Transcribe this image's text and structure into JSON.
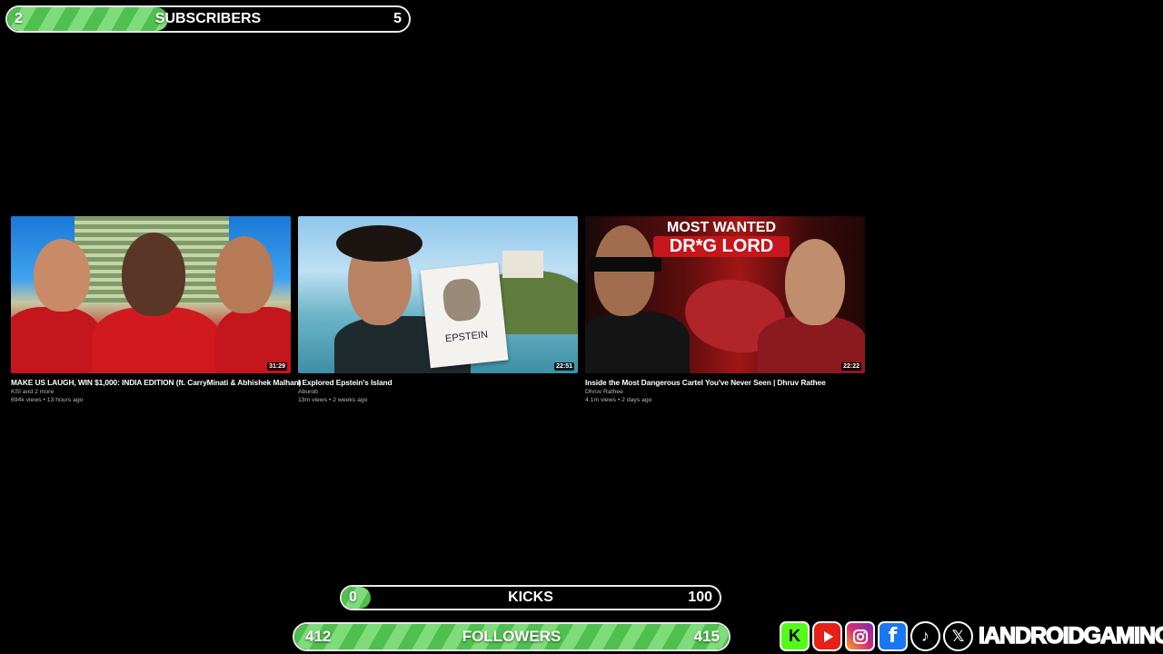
{
  "goals": {
    "subscribers": {
      "label": "SUBSCRIBERS",
      "min": "2",
      "max": "5",
      "progress": 0.4
    },
    "kicks": {
      "label": "KICKS",
      "min": "0",
      "max": "100",
      "progress": 0.0
    },
    "followers": {
      "label": "FOLLOWERS",
      "min": "412",
      "max": "415",
      "progress": 1.0
    }
  },
  "videos": [
    {
      "title": "MAKE US LAUGH, WIN $1,000: INDIA EDITION (ft. CarryMinati & Abhishek Malhan)",
      "channel": "KSI and 2 more",
      "meta": "694k views • 13 hours ago",
      "duration": "31:29"
    },
    {
      "title": "I Explored Epstein's Island",
      "channel": "Aburob",
      "meta": "13m views • 2 weeks ago",
      "duration": "22:51",
      "sign_text": "EPSTEIN"
    },
    {
      "title": "Inside the Most Dangerous Cartel You've Never Seen | Dhruv Rathee",
      "channel": "Dhruv Rathee",
      "meta": "4.1m views • 2 days ago",
      "duration": "22:22",
      "thumb_line1": "MOST WANTED",
      "thumb_line2": "DR*G LORD"
    }
  ],
  "social": {
    "brand": "IANDROIDGAMING",
    "icons": [
      "kick-icon",
      "youtube-icon",
      "instagram-icon",
      "facebook-icon",
      "tiktok-icon",
      "x-icon"
    ],
    "colors": {
      "kick": "#53fc18",
      "youtube": "#e62117",
      "instagram": "#d62976",
      "facebook": "#1877f2"
    }
  }
}
